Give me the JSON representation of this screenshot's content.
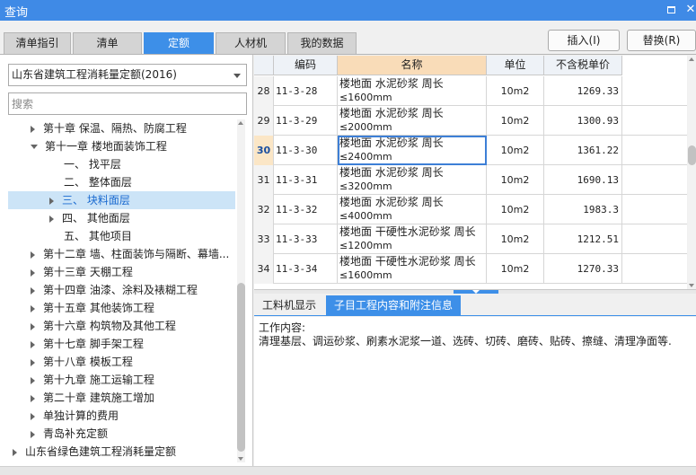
{
  "window": {
    "title": "查询"
  },
  "tabs": [
    {
      "label": "清单指引",
      "active": false
    },
    {
      "label": "清单",
      "active": false
    },
    {
      "label": "定额",
      "active": true
    },
    {
      "label": "人材机",
      "active": false
    },
    {
      "label": "我的数据",
      "active": false
    }
  ],
  "buttons": {
    "insert": "插入(I)",
    "replace": "替换(R)"
  },
  "left": {
    "dropdown_value": "山东省建筑工程消耗量定额(2016)",
    "search_placeholder": "搜索",
    "tree": [
      {
        "label": "第十章 保温、隔热、防腐工程",
        "level": 1,
        "state": "collapsed"
      },
      {
        "label": "第十一章 楼地面装饰工程",
        "level": 1,
        "state": "expanded"
      },
      {
        "label": "一、 找平层",
        "level": 2,
        "state": "leaf"
      },
      {
        "label": "二、 整体面层",
        "level": 2,
        "state": "leaf"
      },
      {
        "label": "三、 块料面层",
        "level": 2,
        "state": "collapsed",
        "selected": true
      },
      {
        "label": "四、 其他面层",
        "level": 2,
        "state": "collapsed"
      },
      {
        "label": "五、 其他项目",
        "level": 2,
        "state": "leaf"
      },
      {
        "label": "第十二章 墙、柱面装饰与隔断、幕墙...",
        "level": 1,
        "state": "collapsed"
      },
      {
        "label": "第十三章 天棚工程",
        "level": 1,
        "state": "collapsed"
      },
      {
        "label": "第十四章 油漆、涂料及裱糊工程",
        "level": 1,
        "state": "collapsed"
      },
      {
        "label": "第十五章 其他装饰工程",
        "level": 1,
        "state": "collapsed"
      },
      {
        "label": "第十六章 构筑物及其他工程",
        "level": 1,
        "state": "collapsed"
      },
      {
        "label": "第十七章 脚手架工程",
        "level": 1,
        "state": "collapsed"
      },
      {
        "label": "第十八章 模板工程",
        "level": 1,
        "state": "collapsed"
      },
      {
        "label": "第十九章 施工运输工程",
        "level": 1,
        "state": "collapsed"
      },
      {
        "label": "第二十章 建筑施工增加",
        "level": 1,
        "state": "collapsed"
      },
      {
        "label": "单独计算的费用",
        "level": 1,
        "state": "collapsed"
      },
      {
        "label": "青岛补充定额",
        "level": 1,
        "state": "collapsed"
      },
      {
        "label": "山东省绿色建筑工程消耗量定额",
        "level": 0,
        "state": "collapsed"
      }
    ]
  },
  "table": {
    "headers": [
      "编码",
      "名称",
      "单位",
      "不含税单价"
    ],
    "rows": [
      {
        "idx": "28",
        "code": "11-3-28",
        "name1": "楼地面 水泥砂浆 周长",
        "name2": "≤1600mm",
        "unit": "10m2",
        "price": "1269.33"
      },
      {
        "idx": "29",
        "code": "11-3-29",
        "name1": "楼地面 水泥砂浆 周长",
        "name2": "≤2000mm",
        "unit": "10m2",
        "price": "1300.93"
      },
      {
        "idx": "30",
        "code": "11-3-30",
        "name1": "楼地面 水泥砂浆 周长",
        "name2": "≤2400mm",
        "unit": "10m2",
        "price": "1361.22",
        "current": true
      },
      {
        "idx": "31",
        "code": "11-3-31",
        "name1": "楼地面 水泥砂浆 周长",
        "name2": "≤3200mm",
        "unit": "10m2",
        "price": "1690.13"
      },
      {
        "idx": "32",
        "code": "11-3-32",
        "name1": "楼地面 水泥砂浆 周长",
        "name2": "≤4000mm",
        "unit": "10m2",
        "price": "1983.3"
      },
      {
        "idx": "33",
        "code": "11-3-33",
        "name1": "楼地面 干硬性水泥砂浆 周长",
        "name2": "≤1200mm",
        "unit": "10m2",
        "price": "1212.51"
      },
      {
        "idx": "34",
        "code": "11-3-34",
        "name1": "楼地面 干硬性水泥砂浆 周长",
        "name2": "≤1600mm",
        "unit": "10m2",
        "price": "1270.33"
      }
    ]
  },
  "bottom": {
    "tabs": [
      {
        "label": "工料机显示",
        "active": false
      },
      {
        "label": "子目工程内容和附注信息",
        "active": true
      }
    ],
    "work_label": "工作内容:",
    "work_text": "清理基层、调运砂浆、刷素水泥浆一道、选砖、切砖、磨砖、贴砖、擦缝、清理净面等."
  },
  "colors": {
    "accent": "#3d8fe8",
    "title_bar": "#3f8ae6",
    "name_header": "#f9dcb8",
    "selection": "#cce4f7"
  }
}
